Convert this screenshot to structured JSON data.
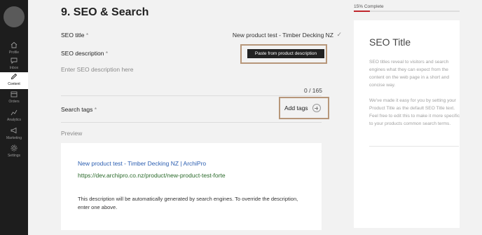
{
  "sidebar": {
    "items": [
      {
        "label": "Profile",
        "icon": "home-icon"
      },
      {
        "label": "Inbox",
        "icon": "chat-icon"
      },
      {
        "label": "Content",
        "icon": "pencil-icon",
        "active": true
      },
      {
        "label": "Orders",
        "icon": "box-icon"
      },
      {
        "label": "Analytics",
        "icon": "chart-icon"
      },
      {
        "label": "Marketing",
        "icon": "megaphone-icon"
      },
      {
        "label": "Settings",
        "icon": "gear-icon"
      }
    ]
  },
  "section": {
    "title": "9. SEO & Search"
  },
  "seo_title": {
    "label": "SEO title",
    "required_mark": "*",
    "value": "New product test - Timber Decking NZ"
  },
  "seo_description": {
    "label": "SEO description",
    "required_mark": "*",
    "paste_button": "Paste from product description",
    "placeholder": "Enter SEO description here",
    "counter": "0 / 165"
  },
  "search_tags": {
    "label": "Search tags",
    "required_mark": "*",
    "add_button": "Add tags"
  },
  "preview": {
    "label": "Preview",
    "title": "New product test - Timber Decking NZ | ArchiPro",
    "url": "https://dev.archipro.co.nz/product/new-product-test-forte",
    "description": "This description will be automatically generated by search engines. To override the description, enter one above."
  },
  "progress": {
    "label": "15% Complete",
    "percent": 15,
    "color": "#c0272d"
  },
  "info": {
    "title": "SEO Title",
    "paragraph1": "SEO titles reveal to visitors and search engines what they can expect from the content on the web page in a short and concise way.",
    "paragraph2": "We've made it easy for you by setting your Product Title as the default SEO Title text. Feel free to edit this to make it more specific to your products common search terms."
  },
  "colors": {
    "accent_outline": "#b7977a",
    "link_blue": "#2a5db0",
    "url_green": "#2a6a2a"
  }
}
